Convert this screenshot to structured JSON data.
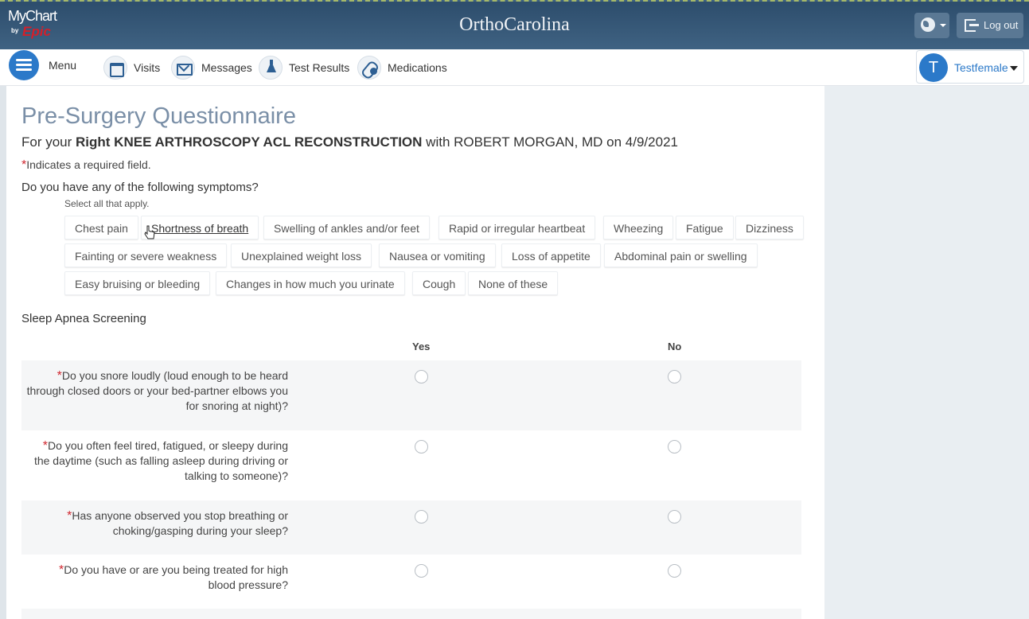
{
  "header": {
    "logo_my": "MyChart",
    "logo_by": "by",
    "logo_epic": "Epic",
    "brand": "OrthoCarolina",
    "language_icon": "globe-icon",
    "logout_label": "Log out"
  },
  "nav": {
    "menu_label": "Menu",
    "items": [
      {
        "label": "Visits",
        "icon": "calendar-icon"
      },
      {
        "label": "Messages",
        "icon": "envelope-icon"
      },
      {
        "label": "Test Results",
        "icon": "flask-icon"
      },
      {
        "label": "Medications",
        "icon": "pill-icon"
      }
    ],
    "user_initial": "T",
    "user_name": "Testfemale"
  },
  "page": {
    "title": "Pre-Surgery Questionnaire",
    "subtitle_prefix": "For your ",
    "subtitle_procedure": "Right KNEE ARTHROSCOPY ACL RECONSTRUCTION",
    "subtitle_suffix": " with ROBERT MORGAN, MD on 4/9/2021",
    "required_star": "*",
    "required_note": "Indicates a required field.",
    "symptom_question": "Do you have any of the following symptoms?",
    "select_note": "Select all that apply.",
    "symptoms": [
      "Chest pain",
      "Shortness of breath",
      "Swelling of ankles and/or feet",
      "Rapid or irregular heartbeat",
      "Wheezing",
      "Fatigue",
      "Dizziness",
      "Fainting or severe weakness",
      "Unexplained weight loss",
      "Nausea or vomiting",
      "Loss of appetite",
      "Abdominal pain or swelling",
      "Easy bruising or bleeding",
      "Changes in how much you urinate",
      "Cough",
      "None of these"
    ],
    "sleep_section": "Sleep Apnea Screening",
    "col_yes": "Yes",
    "col_no": "No",
    "sleep_questions": [
      {
        "text": "Do you snore loudly (loud enough to be heard through closed doors or your bed-partner elbows you for snoring at night)?",
        "answer": null
      },
      {
        "text": "Do you often feel tired, fatigued, or sleepy during the daytime (such as falling asleep during driving or talking to someone)?",
        "answer": null
      },
      {
        "text": "Has anyone observed you stop breathing or choking/gasping during your sleep?",
        "answer": null
      },
      {
        "text": "Do you have or are you being treated for high blood pressure?",
        "answer": null
      }
    ]
  },
  "colors": {
    "header_bg": "#3a5a7a",
    "accent_blue": "#2b79c9",
    "title_color": "#7a8fa7",
    "required_red": "#d0272f"
  }
}
